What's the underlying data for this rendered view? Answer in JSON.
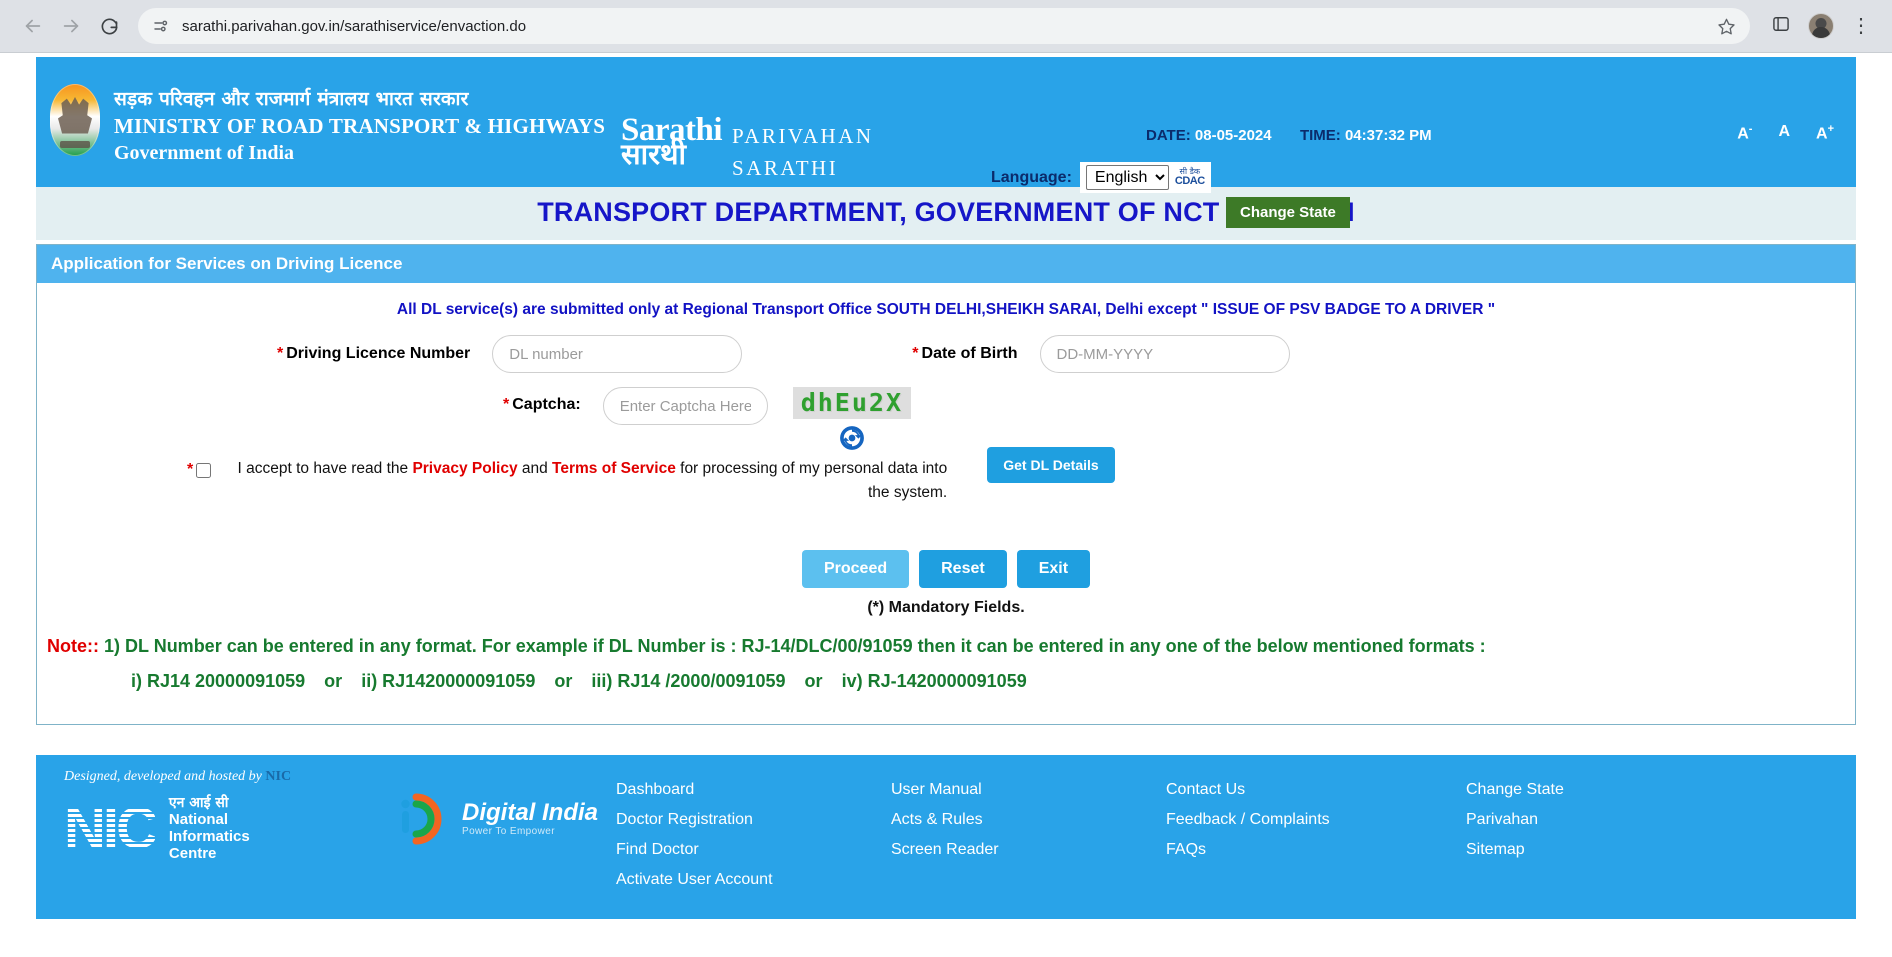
{
  "browser": {
    "url": "sarathi.parivahan.gov.in/sarathiservice/envaction.do",
    "back_icon": "back-arrow-icon",
    "forward_icon": "forward-arrow-icon",
    "reload_icon": "reload-icon",
    "site_info_icon": "site-settings-icon",
    "bookmark_icon": "star-icon",
    "extensions_icon": "extensions-icon",
    "profile_icon": "profile-avatar-icon",
    "menu_icon": "kebab-menu-icon"
  },
  "header": {
    "ministry_hindi": "सड़क परिवहन और राजमार्ग मंत्रालय भारत सरकार",
    "ministry_en1": "MINISTRY OF ROAD TRANSPORT & HIGHWAYS",
    "ministry_en2": "Government of India",
    "logo_mark_latin": "Sarathi",
    "logo_mark_hindi": "सारथी",
    "logo_word1": "PARIVAHAN",
    "logo_word2": "SARATHI",
    "date_label": "DATE:",
    "date_value": "08-05-2024",
    "time_label": "TIME:",
    "time_value": "04:37:32 PM",
    "language_label": "Language:",
    "language_value": "English",
    "language_options": [
      "English"
    ],
    "cdac_hindi": "सी डैक",
    "cdac_latin": "CDAC",
    "change_state_label": "Change State",
    "font_decrease": "A",
    "font_normal": "A",
    "font_increase": "A",
    "font_decrease_sup": "-",
    "font_increase_sup": "+"
  },
  "dept_title": "TRANSPORT DEPARTMENT, GOVERNMENT OF NCT OF DELHI",
  "panel": {
    "title": "Application for Services on Driving Licence",
    "notice": "All DL service(s) are submitted only at Regional Transport Office SOUTH DELHI,SHEIKH SARAI, Delhi except \" ISSUE OF PSV BADGE TO A DRIVER \"",
    "dl_label": "Driving Licence Number",
    "dl_placeholder": "DL number",
    "dl_value": "",
    "dob_label": "Date of Birth",
    "dob_placeholder": "DD-MM-YYYY",
    "dob_value": "",
    "captcha_label": "Captcha:",
    "captcha_placeholder": "Enter Captcha Here",
    "captcha_value": "",
    "captcha_image_text": "dhEu2X",
    "refresh_icon": "refresh-captcha-icon",
    "get_dl_label": "Get DL Details",
    "consent_pre": "I accept to have read the ",
    "consent_link1": "Privacy Policy",
    "consent_mid": " and ",
    "consent_link2": "Terms of Service",
    "consent_post": " for processing of my personal data into the system.",
    "consent_checked": false,
    "proceed_label": "Proceed",
    "reset_label": "Reset",
    "exit_label": "Exit",
    "mandatory_note": "(*) Mandatory Fields.",
    "note_label": "Note::",
    "note_text": "1) DL Number can be entered in any format. For example if DL Number is : RJ-14/DLC/00/91059 then it can be entered in any one of the below mentioned formats :",
    "format_1": "i) RJ14 20000091059",
    "format_2": "ii) RJ1420000091059",
    "format_3": "iii) RJ14 /2000/0091059",
    "format_4": "iv) RJ-1420000091059",
    "or_text": "or"
  },
  "footer": {
    "hosted_by": "Designed, developed and hosted by",
    "hosted_by_nic": "NIC",
    "nic_letters": "NIC",
    "nic_hindi": "एन आई सी",
    "nic_line1": "National",
    "nic_line2": "Informatics",
    "nic_line3": "Centre",
    "digital_india_title": "Digital India",
    "digital_india_sub": "Power To Empower",
    "links": [
      [
        "Dashboard",
        "Doctor Registration",
        "Find Doctor",
        "Activate User Account"
      ],
      [
        "User Manual",
        "Acts & Rules",
        "Screen Reader"
      ],
      [
        "Contact Us",
        "Feedback / Complaints",
        "FAQs"
      ],
      [
        "Change State",
        "Parivahan",
        "Sitemap"
      ]
    ]
  },
  "colors": {
    "header_blue": "#29a3e8",
    "panel_header_blue": "#4fb3ee",
    "title_blue": "#1616c8",
    "accent_green": "#3d7a27",
    "required_red": "#e00000",
    "note_green": "#177a2f",
    "captcha_green": "#2fa02f"
  }
}
